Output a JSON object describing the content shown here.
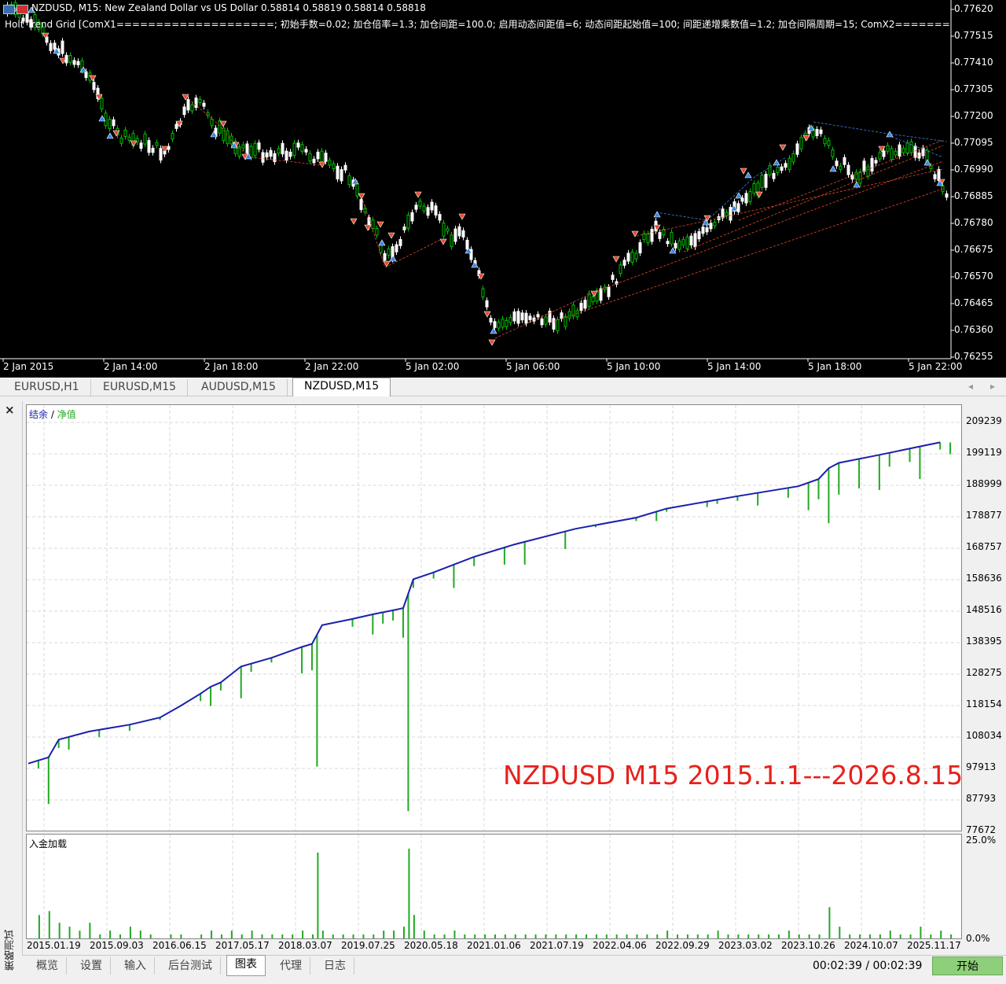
{
  "price_chart": {
    "title": "NZDUSD, M15:  New Zealand Dollar vs US Dollar  0.58814 0.58819 0.58814 0.58818",
    "params": "Holt Trend Grid  [ComX1====================; 初始手数=0.02; 加仓倍率=1.3; 加仓间距=100.0; 启用动态间距值=6; 动态间距起始值=100; 间距递增乘数值=1.2; 加仓间隔周期=15; ComX2=============",
    "price_labels": [
      "0.77620",
      "0.77515",
      "0.77410",
      "0.77305",
      "0.77200",
      "0.77095",
      "0.76990",
      "0.76885",
      "0.76780",
      "0.76675",
      "0.76570",
      "0.76465",
      "0.76360",
      "0.76255"
    ],
    "time_labels": [
      "2 Jan 2015",
      "2 Jan 14:00",
      "2 Jan 18:00",
      "2 Jan 22:00",
      "5 Jan 02:00",
      "5 Jan 06:00",
      "5 Jan 10:00",
      "5 Jan 14:00",
      "5 Jan 18:00",
      "5 Jan 22:00"
    ],
    "colors": {
      "background": "#000000",
      "bull": "#00c000",
      "bear": "#ffffff",
      "sell_arrow": "#e84a2a",
      "buy_arrow": "#3a86e8",
      "grid_line_sell": "#e84a2a",
      "grid_line_buy": "#3a86e8"
    }
  },
  "tabs": [
    "EURUSD,H1",
    "EURUSD,M15",
    "AUDUSD,M15",
    "NZDUSD,M15"
  ],
  "active_tab": "NZDUSD,M15",
  "tab_nav": [
    "◂",
    "▸"
  ],
  "tester": {
    "close_label": "×",
    "side_label": "策略测试",
    "legend_balance": "结余",
    "legend_sep": " / ",
    "legend_equity": "净值",
    "deposit_label": "入金加载",
    "overlay": "NZDUSD M15 2015.1.1---2026.8.15",
    "start_button": "开始",
    "timer": "00:02:39 / 00:02:39",
    "bottom_tabs": [
      "概览",
      "设置",
      "输入",
      "后台测试",
      "图表",
      "代理",
      "日志"
    ],
    "active_bottom_tab": "图表"
  },
  "chart_data": [
    {
      "type": "line",
      "series": [
        {
          "name": "结余",
          "color": "#1b1fae"
        },
        {
          "name": "净值",
          "color": "#22a822"
        }
      ],
      "x": [
        "2015.01.19",
        "2015.09.03",
        "2016.06.15",
        "2017.05.17",
        "2018.03.07",
        "2019.07.25",
        "2020.05.18",
        "2021.01.06",
        "2021.07.19",
        "2022.04.06",
        "2022.09.29",
        "2023.03.02",
        "2023.10.26",
        "2024.10.07",
        "2025.11.17"
      ],
      "y_ticks": [
        209239,
        199119,
        188999,
        178877,
        168757,
        158636,
        148516,
        138395,
        128275,
        118154,
        108034,
        97913,
        87793,
        77672
      ],
      "ylim": [
        77672,
        209239
      ],
      "balance_points": [
        [
          0,
          99500
        ],
        [
          2,
          101500
        ],
        [
          3,
          107200
        ],
        [
          6,
          109800
        ],
        [
          10,
          112000
        ],
        [
          13,
          114300
        ],
        [
          15,
          118000
        ],
        [
          17,
          122000
        ],
        [
          18,
          124200
        ],
        [
          19,
          125600
        ],
        [
          21,
          130700
        ],
        [
          24,
          133500
        ],
        [
          27,
          137000
        ],
        [
          28,
          138000
        ],
        [
          29,
          144000
        ],
        [
          32,
          146000
        ],
        [
          34,
          147500
        ],
        [
          36,
          148800
        ],
        [
          37,
          149500
        ],
        [
          38,
          158800
        ],
        [
          40,
          161000
        ],
        [
          42,
          163500
        ],
        [
          44,
          166000
        ],
        [
          48,
          170000
        ],
        [
          54,
          175000
        ],
        [
          60,
          178600
        ],
        [
          63,
          181500
        ],
        [
          70,
          185500
        ],
        [
          76,
          188700
        ],
        [
          78,
          191000
        ],
        [
          79,
          194500
        ],
        [
          80,
          196200
        ],
        [
          84,
          198800
        ],
        [
          88,
          201500
        ],
        [
          90,
          202800
        ]
      ],
      "equity_dips": [
        [
          1,
          97913
        ],
        [
          2,
          86500
        ],
        [
          3,
          104500
        ],
        [
          4,
          104000
        ],
        [
          7,
          108000
        ],
        [
          10,
          110000
        ],
        [
          13,
          113500
        ],
        [
          17,
          119600
        ],
        [
          18,
          118000
        ],
        [
          19,
          123000
        ],
        [
          21,
          120500
        ],
        [
          22,
          129000
        ],
        [
          24,
          132000
        ],
        [
          27,
          128500
        ],
        [
          28,
          129500
        ],
        [
          28.5,
          98500
        ],
        [
          32,
          143500
        ],
        [
          34,
          141000
        ],
        [
          35,
          144500
        ],
        [
          36,
          145500
        ],
        [
          37,
          140000
        ],
        [
          37.5,
          84200
        ],
        [
          38,
          156000
        ],
        [
          40,
          159000
        ],
        [
          42,
          156000
        ],
        [
          44,
          163000
        ],
        [
          47,
          163500
        ],
        [
          49,
          163500
        ],
        [
          53,
          168500
        ],
        [
          56,
          175500
        ],
        [
          60,
          177500
        ],
        [
          62,
          177500
        ],
        [
          63,
          180500
        ],
        [
          65,
          182500
        ],
        [
          67,
          182000
        ],
        [
          68,
          183000
        ],
        [
          70,
          184000
        ],
        [
          72,
          182500
        ],
        [
          75,
          185000
        ],
        [
          77,
          181000
        ],
        [
          78,
          184500
        ],
        [
          79,
          176800
        ],
        [
          80,
          186000
        ],
        [
          82,
          188000
        ],
        [
          84,
          187500
        ],
        [
          85,
          195000
        ],
        [
          87,
          196500
        ],
        [
          88,
          191000
        ],
        [
          90,
          200500
        ],
        [
          91,
          199000
        ]
      ],
      "series_order": "balance above equity"
    },
    {
      "type": "bar",
      "series": [
        {
          "name": "入金加载",
          "color": "#22a822"
        }
      ],
      "y_ticks": [
        "25.0%",
        "0.0%"
      ],
      "ylim": [
        0,
        25
      ],
      "bars": [
        [
          1,
          6
        ],
        [
          2,
          7
        ],
        [
          3,
          4
        ],
        [
          4,
          3
        ],
        [
          5,
          2
        ],
        [
          6,
          4
        ],
        [
          7,
          1
        ],
        [
          8,
          2
        ],
        [
          9,
          1
        ],
        [
          10,
          3
        ],
        [
          11,
          2
        ],
        [
          12,
          1
        ],
        [
          14,
          1
        ],
        [
          15,
          1
        ],
        [
          17,
          1
        ],
        [
          18,
          2
        ],
        [
          19,
          1
        ],
        [
          20,
          2
        ],
        [
          21,
          1
        ],
        [
          22,
          2
        ],
        [
          23,
          1
        ],
        [
          24,
          1
        ],
        [
          25,
          1
        ],
        [
          26,
          1
        ],
        [
          27,
          2
        ],
        [
          28,
          1
        ],
        [
          28.5,
          22
        ],
        [
          29,
          2
        ],
        [
          30,
          1
        ],
        [
          31,
          1
        ],
        [
          32,
          1
        ],
        [
          33,
          1
        ],
        [
          34,
          1
        ],
        [
          35,
          2
        ],
        [
          36,
          2
        ],
        [
          37,
          3
        ],
        [
          37.5,
          23
        ],
        [
          38,
          6
        ],
        [
          39,
          2
        ],
        [
          40,
          1
        ],
        [
          41,
          1
        ],
        [
          42,
          2
        ],
        [
          43,
          1
        ],
        [
          44,
          1
        ],
        [
          45,
          1
        ],
        [
          46,
          1
        ],
        [
          47,
          1
        ],
        [
          48,
          1
        ],
        [
          49,
          1
        ],
        [
          50,
          1
        ],
        [
          51,
          1
        ],
        [
          52,
          1
        ],
        [
          53,
          1
        ],
        [
          54,
          1
        ],
        [
          55,
          1
        ],
        [
          56,
          1
        ],
        [
          57,
          1
        ],
        [
          58,
          1
        ],
        [
          59,
          1
        ],
        [
          60,
          1
        ],
        [
          61,
          1
        ],
        [
          62,
          1
        ],
        [
          63,
          2
        ],
        [
          64,
          1
        ],
        [
          65,
          1
        ],
        [
          66,
          1
        ],
        [
          67,
          1
        ],
        [
          68,
          2
        ],
        [
          69,
          1
        ],
        [
          70,
          1
        ],
        [
          71,
          1
        ],
        [
          72,
          1
        ],
        [
          73,
          1
        ],
        [
          74,
          1
        ],
        [
          75,
          2
        ],
        [
          76,
          1
        ],
        [
          77,
          1
        ],
        [
          78,
          1
        ],
        [
          79,
          8
        ],
        [
          80,
          3
        ],
        [
          81,
          1
        ],
        [
          82,
          1
        ],
        [
          83,
          1
        ],
        [
          84,
          1
        ],
        [
          85,
          2
        ],
        [
          86,
          1
        ],
        [
          87,
          1
        ],
        [
          88,
          3
        ],
        [
          89,
          1
        ],
        [
          90,
          2
        ],
        [
          91,
          1
        ]
      ]
    }
  ]
}
